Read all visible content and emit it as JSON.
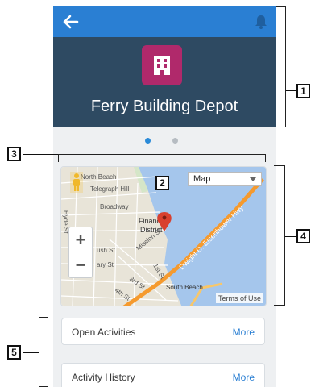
{
  "header": {
    "title": "Ferry Building Depot"
  },
  "icons": {
    "back": "back-arrow-icon",
    "notifications": "bell-icon",
    "record": "building-icon"
  },
  "carousel": {
    "pages": 2,
    "active": 1
  },
  "map": {
    "type_label": "Map",
    "zoom_in": "+",
    "zoom_out": "−",
    "terms": "Terms of Use",
    "labels": [
      "North Beach",
      "Telegraph Hill",
      "Broadway",
      "Hyde St",
      "Financial",
      "District",
      "Mission St",
      "1st St",
      "ush St",
      "ary St",
      "3rd St",
      "4th St",
      "South Beach",
      "Dwight D. Eisenhower Hwy"
    ]
  },
  "related_lists": [
    {
      "label": "Open Activities",
      "action": "More"
    },
    {
      "label": "Activity History",
      "action": "More"
    }
  ],
  "annotations": [
    "1",
    "2",
    "3",
    "4",
    "5"
  ],
  "colors": {
    "topbar": "#2a7fd3",
    "hero": "#2e4a62",
    "record_icon": "#b0296b",
    "link": "#2a7fd3"
  }
}
